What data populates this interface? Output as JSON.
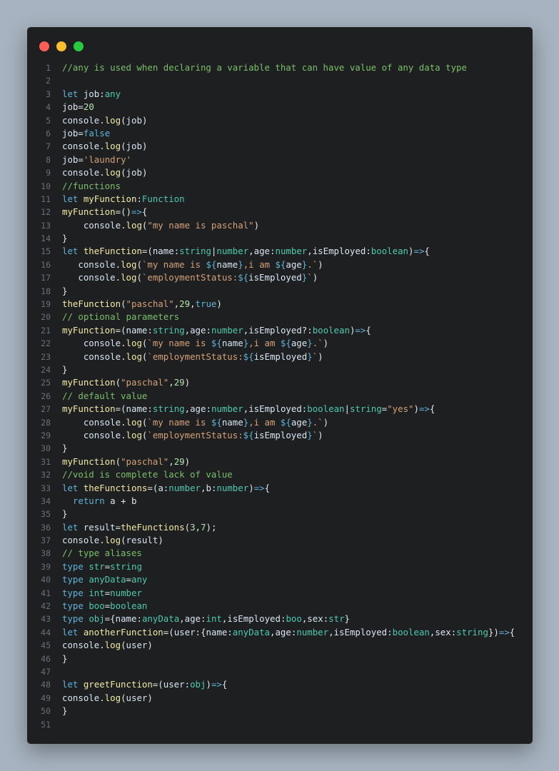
{
  "window": {
    "controls": [
      "close",
      "minimize",
      "maximize"
    ],
    "colors": {
      "close": "#ff5f57",
      "minimize": "#febc2e",
      "maximize": "#28c840",
      "background": "#1e1f21"
    }
  },
  "code": {
    "lines": [
      [
        [
          "comment",
          "//any is used when declaring a variable that can have value of any data type"
        ]
      ],
      [],
      [
        [
          "keyword",
          "let "
        ],
        [
          "var",
          "job"
        ],
        [
          "punct",
          ":"
        ],
        [
          "type",
          "any"
        ]
      ],
      [
        [
          "var",
          "job"
        ],
        [
          "op",
          "="
        ],
        [
          "number",
          "20"
        ]
      ],
      [
        [
          "var",
          "console"
        ],
        [
          "punct",
          "."
        ],
        [
          "func",
          "log"
        ],
        [
          "punct",
          "("
        ],
        [
          "var",
          "job"
        ],
        [
          "punct",
          ")"
        ]
      ],
      [
        [
          "var",
          "job"
        ],
        [
          "op",
          "="
        ],
        [
          "keyword",
          "false"
        ]
      ],
      [
        [
          "var",
          "console"
        ],
        [
          "punct",
          "."
        ],
        [
          "func",
          "log"
        ],
        [
          "punct",
          "("
        ],
        [
          "var",
          "job"
        ],
        [
          "punct",
          ")"
        ]
      ],
      [
        [
          "var",
          "job"
        ],
        [
          "op",
          "="
        ],
        [
          "string",
          "'laundry'"
        ]
      ],
      [
        [
          "var",
          "console"
        ],
        [
          "punct",
          "."
        ],
        [
          "func",
          "log"
        ],
        [
          "punct",
          "("
        ],
        [
          "var",
          "job"
        ],
        [
          "punct",
          ")"
        ]
      ],
      [
        [
          "comment",
          "//functions"
        ]
      ],
      [
        [
          "keyword",
          "let "
        ],
        [
          "func",
          "myFunction"
        ],
        [
          "punct",
          ":"
        ],
        [
          "type",
          "Function"
        ]
      ],
      [
        [
          "func",
          "myFunction"
        ],
        [
          "op",
          "="
        ],
        [
          "punct",
          "()"
        ],
        [
          "keyword",
          "=>"
        ],
        [
          "punct",
          "{"
        ]
      ],
      [
        [
          "punct",
          "    "
        ],
        [
          "var",
          "console"
        ],
        [
          "punct",
          "."
        ],
        [
          "func",
          "log"
        ],
        [
          "punct",
          "("
        ],
        [
          "string",
          "\"my name is paschal\""
        ],
        [
          "punct",
          ")"
        ]
      ],
      [
        [
          "punct",
          "}"
        ]
      ],
      [
        [
          "keyword",
          "let "
        ],
        [
          "func",
          "theFunction"
        ],
        [
          "op",
          "="
        ],
        [
          "punct",
          "("
        ],
        [
          "var",
          "name"
        ],
        [
          "punct",
          ":"
        ],
        [
          "type",
          "string"
        ],
        [
          "op",
          "|"
        ],
        [
          "type",
          "number"
        ],
        [
          "punct",
          ","
        ],
        [
          "var",
          "age"
        ],
        [
          "punct",
          ":"
        ],
        [
          "type",
          "number"
        ],
        [
          "punct",
          ","
        ],
        [
          "var",
          "isEmployed"
        ],
        [
          "punct",
          ":"
        ],
        [
          "type",
          "boolean"
        ],
        [
          "punct",
          ")"
        ],
        [
          "keyword",
          "=>"
        ],
        [
          "punct",
          "{"
        ]
      ],
      [
        [
          "punct",
          "   "
        ],
        [
          "var",
          "console"
        ],
        [
          "punct",
          "."
        ],
        [
          "func",
          "log"
        ],
        [
          "punct",
          "("
        ],
        [
          "string",
          "`my name is "
        ],
        [
          "keyword",
          "${"
        ],
        [
          "var",
          "name"
        ],
        [
          "keyword",
          "}"
        ],
        [
          "string",
          ",i am "
        ],
        [
          "keyword",
          "${"
        ],
        [
          "var",
          "age"
        ],
        [
          "keyword",
          "}"
        ],
        [
          "string",
          ".`"
        ],
        [
          "punct",
          ")"
        ]
      ],
      [
        [
          "punct",
          "   "
        ],
        [
          "var",
          "console"
        ],
        [
          "punct",
          "."
        ],
        [
          "func",
          "log"
        ],
        [
          "punct",
          "("
        ],
        [
          "string",
          "`employmentStatus:"
        ],
        [
          "keyword",
          "${"
        ],
        [
          "var",
          "isEmployed"
        ],
        [
          "keyword",
          "}"
        ],
        [
          "string",
          "`"
        ],
        [
          "punct",
          ")"
        ]
      ],
      [
        [
          "punct",
          "}"
        ]
      ],
      [
        [
          "func",
          "theFunction"
        ],
        [
          "punct",
          "("
        ],
        [
          "string",
          "\"paschal\""
        ],
        [
          "punct",
          ","
        ],
        [
          "number",
          "29"
        ],
        [
          "punct",
          ","
        ],
        [
          "keyword",
          "true"
        ],
        [
          "punct",
          ")"
        ]
      ],
      [
        [
          "comment",
          "// optional parameters"
        ]
      ],
      [
        [
          "func",
          "myFunction"
        ],
        [
          "op",
          "="
        ],
        [
          "punct",
          "("
        ],
        [
          "var",
          "name"
        ],
        [
          "punct",
          ":"
        ],
        [
          "type",
          "string"
        ],
        [
          "punct",
          ","
        ],
        [
          "var",
          "age"
        ],
        [
          "punct",
          ":"
        ],
        [
          "type",
          "number"
        ],
        [
          "punct",
          ","
        ],
        [
          "var",
          "isEmployed"
        ],
        [
          "op",
          "?:"
        ],
        [
          "type",
          "boolean"
        ],
        [
          "punct",
          ")"
        ],
        [
          "keyword",
          "=>"
        ],
        [
          "punct",
          "{"
        ]
      ],
      [
        [
          "punct",
          "    "
        ],
        [
          "var",
          "console"
        ],
        [
          "punct",
          "."
        ],
        [
          "func",
          "log"
        ],
        [
          "punct",
          "("
        ],
        [
          "string",
          "`my name is "
        ],
        [
          "keyword",
          "${"
        ],
        [
          "var",
          "name"
        ],
        [
          "keyword",
          "}"
        ],
        [
          "string",
          ",i am "
        ],
        [
          "keyword",
          "${"
        ],
        [
          "var",
          "age"
        ],
        [
          "keyword",
          "}"
        ],
        [
          "string",
          ".`"
        ],
        [
          "punct",
          ")"
        ]
      ],
      [
        [
          "punct",
          "    "
        ],
        [
          "var",
          "console"
        ],
        [
          "punct",
          "."
        ],
        [
          "func",
          "log"
        ],
        [
          "punct",
          "("
        ],
        [
          "string",
          "`employmentStatus:"
        ],
        [
          "keyword",
          "${"
        ],
        [
          "var",
          "isEmployed"
        ],
        [
          "keyword",
          "}"
        ],
        [
          "string",
          "`"
        ],
        [
          "punct",
          ")"
        ]
      ],
      [
        [
          "punct",
          "}"
        ]
      ],
      [
        [
          "func",
          "myFunction"
        ],
        [
          "punct",
          "("
        ],
        [
          "string",
          "\"paschal\""
        ],
        [
          "punct",
          ","
        ],
        [
          "number",
          "29"
        ],
        [
          "punct",
          ")"
        ]
      ],
      [
        [
          "comment",
          "// default value"
        ]
      ],
      [
        [
          "func",
          "myFunction"
        ],
        [
          "op",
          "="
        ],
        [
          "punct",
          "("
        ],
        [
          "var",
          "name"
        ],
        [
          "punct",
          ":"
        ],
        [
          "type",
          "string"
        ],
        [
          "punct",
          ","
        ],
        [
          "var",
          "age"
        ],
        [
          "punct",
          ":"
        ],
        [
          "type",
          "number"
        ],
        [
          "punct",
          ","
        ],
        [
          "var",
          "isEmployed"
        ],
        [
          "punct",
          ":"
        ],
        [
          "type",
          "boolean"
        ],
        [
          "op",
          "|"
        ],
        [
          "type",
          "string"
        ],
        [
          "op",
          "="
        ],
        [
          "string",
          "\"yes\""
        ],
        [
          "punct",
          ")"
        ],
        [
          "keyword",
          "=>"
        ],
        [
          "punct",
          "{"
        ]
      ],
      [
        [
          "punct",
          "    "
        ],
        [
          "var",
          "console"
        ],
        [
          "punct",
          "."
        ],
        [
          "func",
          "log"
        ],
        [
          "punct",
          "("
        ],
        [
          "string",
          "`my name is "
        ],
        [
          "keyword",
          "${"
        ],
        [
          "var",
          "name"
        ],
        [
          "keyword",
          "}"
        ],
        [
          "string",
          ",i am "
        ],
        [
          "keyword",
          "${"
        ],
        [
          "var",
          "age"
        ],
        [
          "keyword",
          "}"
        ],
        [
          "string",
          ".`"
        ],
        [
          "punct",
          ")"
        ]
      ],
      [
        [
          "punct",
          "    "
        ],
        [
          "var",
          "console"
        ],
        [
          "punct",
          "."
        ],
        [
          "func",
          "log"
        ],
        [
          "punct",
          "("
        ],
        [
          "string",
          "`employmentStatus:"
        ],
        [
          "keyword",
          "${"
        ],
        [
          "var",
          "isEmployed"
        ],
        [
          "keyword",
          "}"
        ],
        [
          "string",
          "`"
        ],
        [
          "punct",
          ")"
        ]
      ],
      [
        [
          "punct",
          "}"
        ]
      ],
      [
        [
          "func",
          "myFunction"
        ],
        [
          "punct",
          "("
        ],
        [
          "string",
          "\"paschal\""
        ],
        [
          "punct",
          ","
        ],
        [
          "number",
          "29"
        ],
        [
          "punct",
          ")"
        ]
      ],
      [
        [
          "comment",
          "//void is complete lack of value"
        ]
      ],
      [
        [
          "keyword",
          "let "
        ],
        [
          "func",
          "theFunctions"
        ],
        [
          "op",
          "="
        ],
        [
          "punct",
          "("
        ],
        [
          "var",
          "a"
        ],
        [
          "punct",
          ":"
        ],
        [
          "type",
          "number"
        ],
        [
          "punct",
          ","
        ],
        [
          "var",
          "b"
        ],
        [
          "punct",
          ":"
        ],
        [
          "type",
          "number"
        ],
        [
          "punct",
          ")"
        ],
        [
          "keyword",
          "=>"
        ],
        [
          "punct",
          "{"
        ]
      ],
      [
        [
          "punct",
          "  "
        ],
        [
          "keyword",
          "return "
        ],
        [
          "var",
          "a"
        ],
        [
          "op",
          " + "
        ],
        [
          "var",
          "b"
        ]
      ],
      [
        [
          "punct",
          "}"
        ]
      ],
      [
        [
          "keyword",
          "let "
        ],
        [
          "var",
          "result"
        ],
        [
          "op",
          "="
        ],
        [
          "func",
          "theFunctions"
        ],
        [
          "punct",
          "("
        ],
        [
          "number",
          "3"
        ],
        [
          "punct",
          ","
        ],
        [
          "number",
          "7"
        ],
        [
          "punct",
          ");"
        ]
      ],
      [
        [
          "var",
          "console"
        ],
        [
          "punct",
          "."
        ],
        [
          "func",
          "log"
        ],
        [
          "punct",
          "("
        ],
        [
          "var",
          "result"
        ],
        [
          "punct",
          ")"
        ]
      ],
      [
        [
          "comment",
          "// type aliases"
        ]
      ],
      [
        [
          "keyword",
          "type "
        ],
        [
          "type",
          "str"
        ],
        [
          "op",
          "="
        ],
        [
          "type",
          "string"
        ]
      ],
      [
        [
          "keyword",
          "type "
        ],
        [
          "type",
          "anyData"
        ],
        [
          "op",
          "="
        ],
        [
          "type",
          "any"
        ]
      ],
      [
        [
          "keyword",
          "type "
        ],
        [
          "type",
          "int"
        ],
        [
          "op",
          "="
        ],
        [
          "type",
          "number"
        ]
      ],
      [
        [
          "keyword",
          "type "
        ],
        [
          "type",
          "boo"
        ],
        [
          "op",
          "="
        ],
        [
          "type",
          "boolean"
        ]
      ],
      [
        [
          "keyword",
          "type "
        ],
        [
          "type",
          "obj"
        ],
        [
          "op",
          "="
        ],
        [
          "punct",
          "{"
        ],
        [
          "var",
          "name"
        ],
        [
          "punct",
          ":"
        ],
        [
          "type",
          "anyData"
        ],
        [
          "punct",
          ","
        ],
        [
          "var",
          "age"
        ],
        [
          "punct",
          ":"
        ],
        [
          "type",
          "int"
        ],
        [
          "punct",
          ","
        ],
        [
          "var",
          "isEmployed"
        ],
        [
          "punct",
          ":"
        ],
        [
          "type",
          "boo"
        ],
        [
          "punct",
          ","
        ],
        [
          "var",
          "sex"
        ],
        [
          "punct",
          ":"
        ],
        [
          "type",
          "str"
        ],
        [
          "punct",
          "}"
        ]
      ],
      [
        [
          "keyword",
          "let "
        ],
        [
          "func",
          "anotherFunction"
        ],
        [
          "op",
          "="
        ],
        [
          "punct",
          "("
        ],
        [
          "var",
          "user"
        ],
        [
          "punct",
          ":{"
        ],
        [
          "var",
          "name"
        ],
        [
          "punct",
          ":"
        ],
        [
          "type",
          "anyData"
        ],
        [
          "punct",
          ","
        ],
        [
          "var",
          "age"
        ],
        [
          "punct",
          ":"
        ],
        [
          "type",
          "number"
        ],
        [
          "punct",
          ","
        ],
        [
          "var",
          "isEmployed"
        ],
        [
          "punct",
          ":"
        ],
        [
          "type",
          "boolean"
        ],
        [
          "punct",
          ","
        ],
        [
          "var",
          "sex"
        ],
        [
          "punct",
          ":"
        ],
        [
          "type",
          "string"
        ],
        [
          "punct",
          "})"
        ],
        [
          "keyword",
          "=>"
        ],
        [
          "punct",
          "{"
        ]
      ],
      [
        [
          "var",
          "console"
        ],
        [
          "punct",
          "."
        ],
        [
          "func",
          "log"
        ],
        [
          "punct",
          "("
        ],
        [
          "var",
          "user"
        ],
        [
          "punct",
          ")"
        ]
      ],
      [
        [
          "punct",
          "}"
        ]
      ],
      [],
      [
        [
          "keyword",
          "let "
        ],
        [
          "func",
          "greetFunction"
        ],
        [
          "op",
          "="
        ],
        [
          "punct",
          "("
        ],
        [
          "var",
          "user"
        ],
        [
          "punct",
          ":"
        ],
        [
          "type",
          "obj"
        ],
        [
          "punct",
          ")"
        ],
        [
          "keyword",
          "=>"
        ],
        [
          "punct",
          "{"
        ]
      ],
      [
        [
          "var",
          "console"
        ],
        [
          "punct",
          "."
        ],
        [
          "func",
          "log"
        ],
        [
          "punct",
          "("
        ],
        [
          "var",
          "user"
        ],
        [
          "punct",
          ")"
        ]
      ],
      [
        [
          "punct",
          "}"
        ]
      ],
      []
    ]
  }
}
